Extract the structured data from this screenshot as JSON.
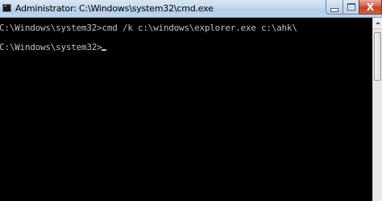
{
  "window": {
    "title": "Administrator: C:\\Windows\\system32\\cmd.exe",
    "icon": "cmd-icon",
    "controls": {
      "minimize": "minimize-icon",
      "maximize": "maximize-icon",
      "close_glyph": "X"
    }
  },
  "console": {
    "lines": [
      "C:\\Windows\\system32>cmd /k c:\\windows\\explorer.exe c:\\ahk\\",
      "",
      "C:\\Windows\\system32>"
    ],
    "text_color": "#c0c0c0",
    "background_color": "#000000"
  }
}
